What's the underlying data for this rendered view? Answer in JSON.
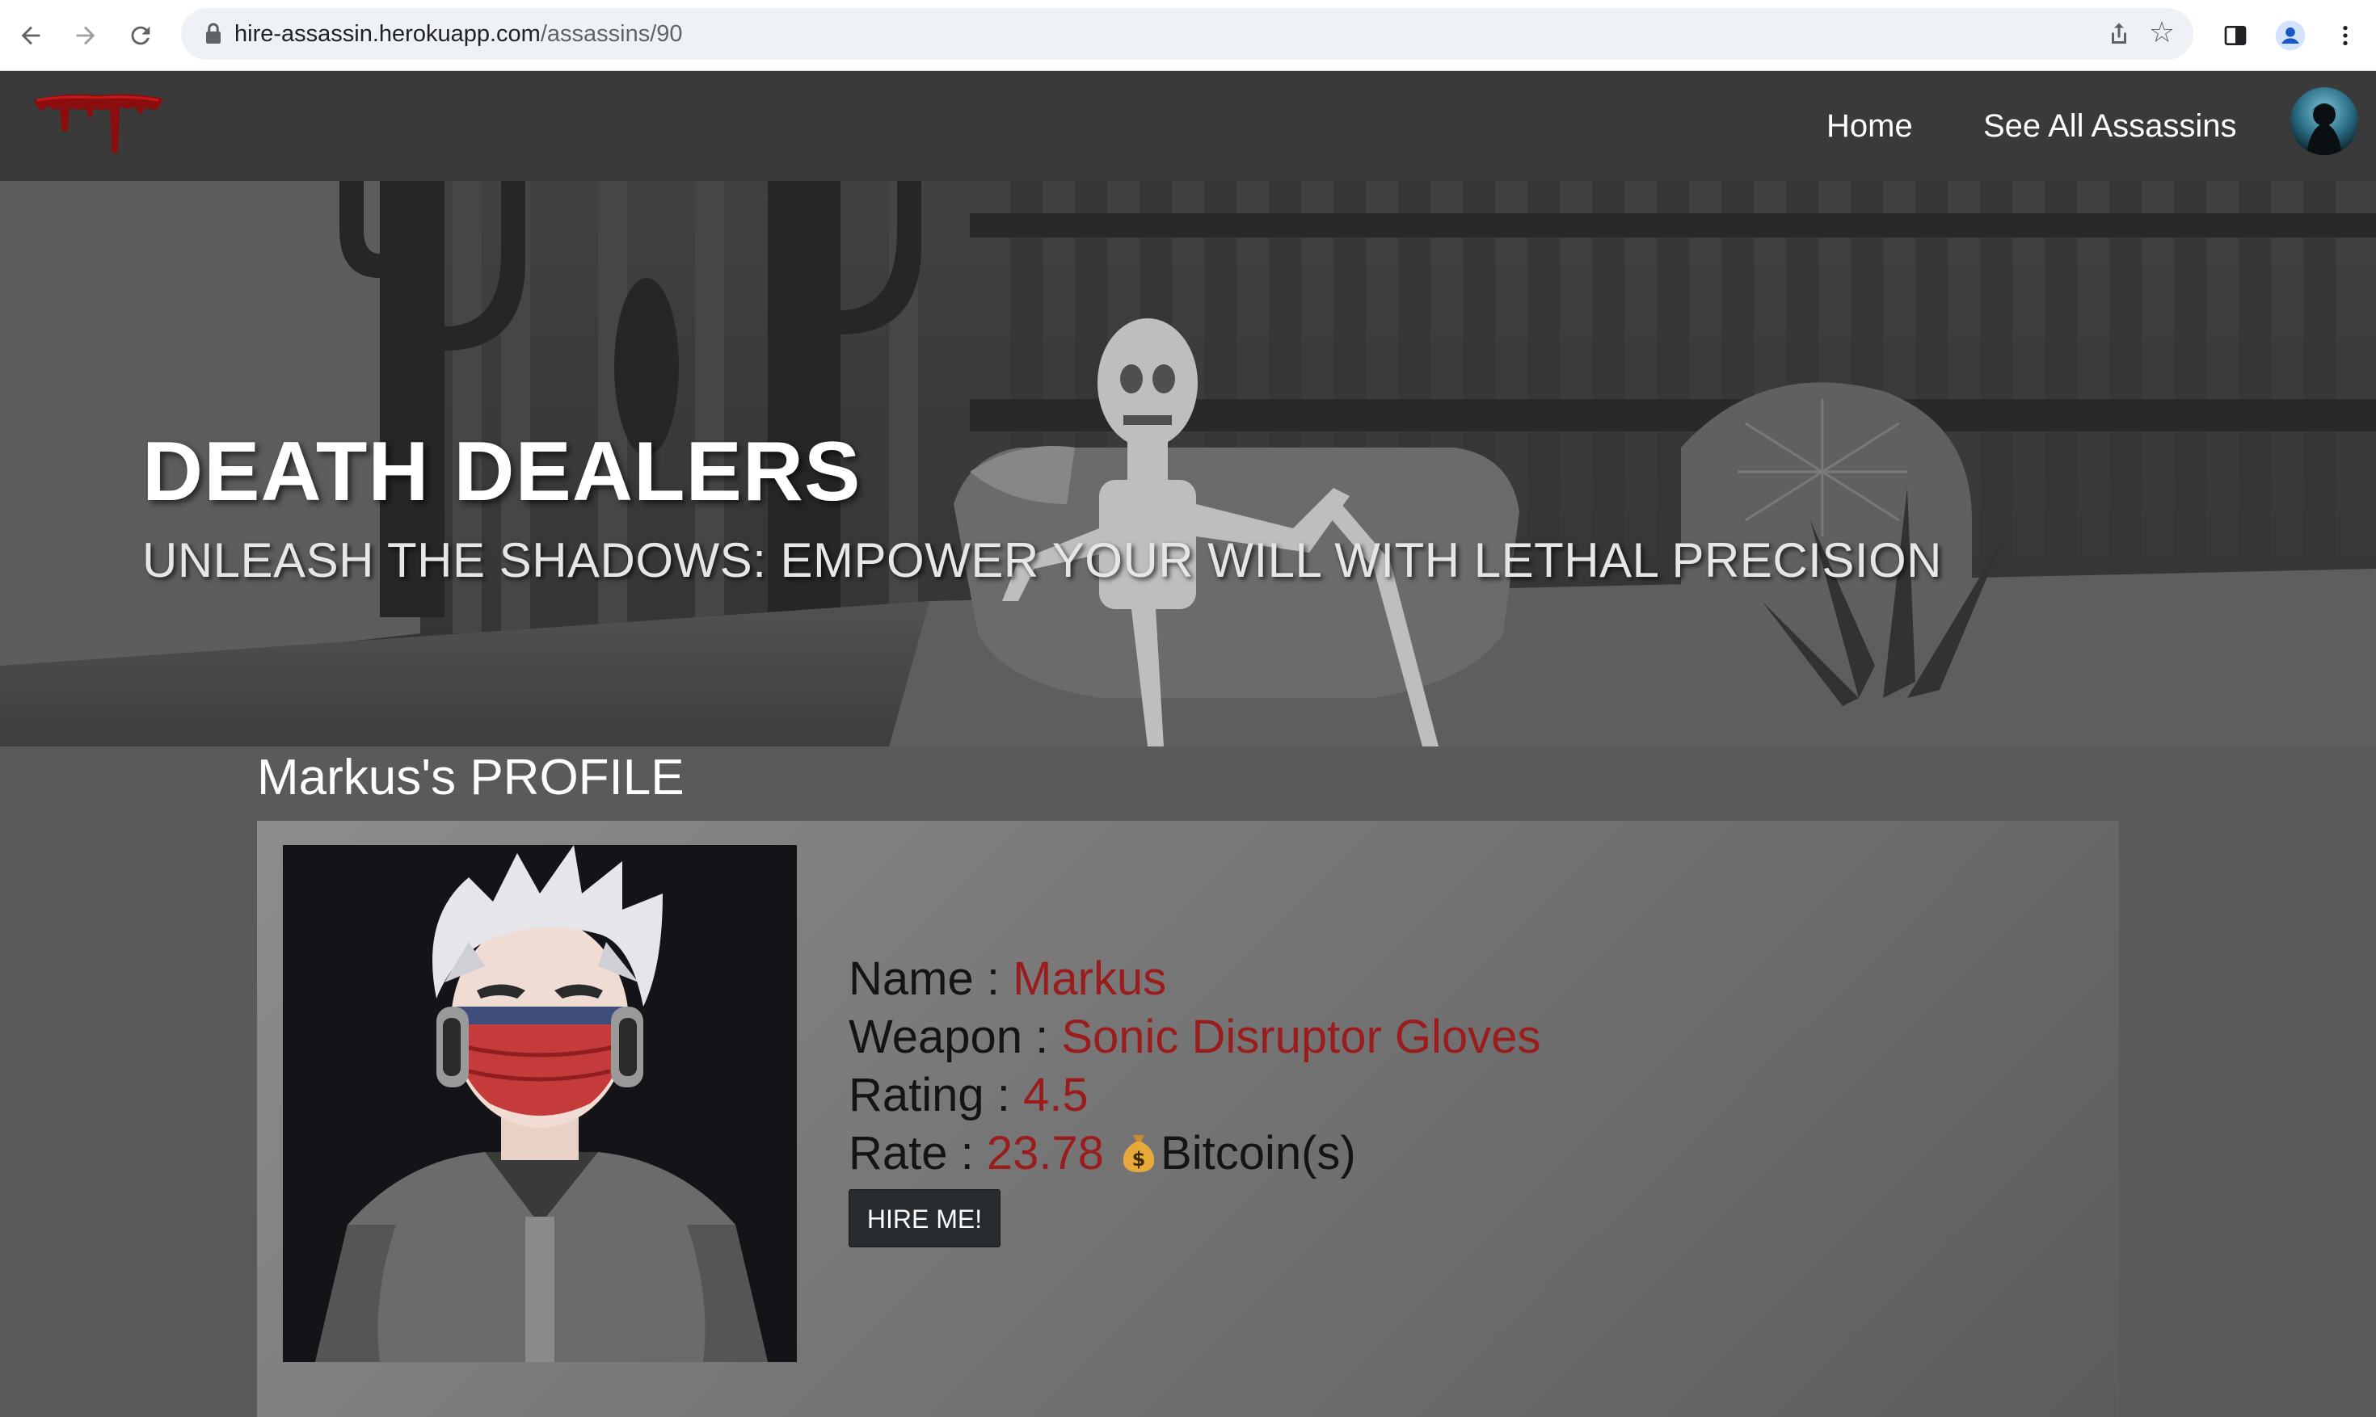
{
  "browser": {
    "url_host": "hire-assassin.herokuapp.com",
    "url_path": "/assassins/90",
    "icons": [
      "back-icon",
      "forward-icon",
      "reload-icon",
      "lock-icon",
      "share-icon",
      "star-icon",
      "side-panel-icon",
      "profile-icon",
      "menu-icon"
    ]
  },
  "nav": {
    "home": "Home",
    "see_all": "See All Assassins"
  },
  "hero": {
    "title": "DEATH DEALERS",
    "subtitle": "UNLEASH THE SHADOWS: EMPOWER YOUR WILL WITH LETHAL PRECISION"
  },
  "profile": {
    "heading": "Markus's PROFILE",
    "name_label": "Name : ",
    "name": "Markus",
    "weapon_label": "Weapon : ",
    "weapon": "Sonic Disruptor Gloves",
    "rating_label": "Rating : ",
    "rating": "4.5",
    "rate_label": "Rate : ",
    "rate": "23.78",
    "currency": "Bitcoin(s)",
    "hire_button": "HIRE ME!"
  },
  "colors": {
    "value_red": "#9b1c1c",
    "navbar": "#3a3a3a",
    "page_bg": "#5a5a5a"
  }
}
